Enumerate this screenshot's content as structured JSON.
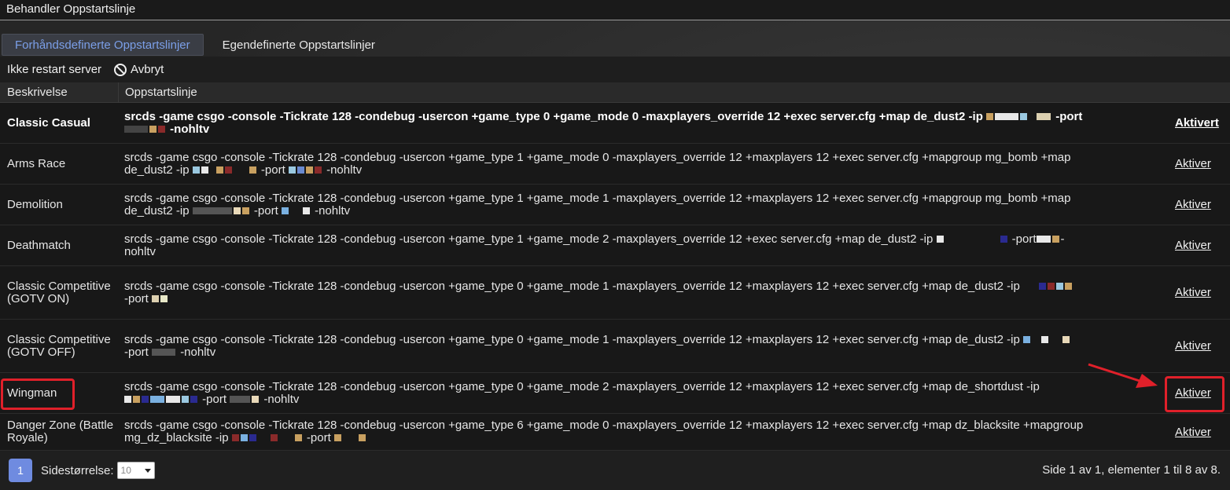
{
  "window": {
    "title": "Behandler Oppstartslinje"
  },
  "tabs": [
    {
      "label": "Forhåndsdefinerte Oppstartslinjer",
      "active": true
    },
    {
      "label": "Egendefinerte Oppstartslinjer",
      "active": false
    }
  ],
  "toolbar": {
    "no_restart_label": "Ikke restart server",
    "cancel_label": "Avbryt",
    "cancel_icon": "cancel-icon"
  },
  "table": {
    "headers": {
      "description": "Beskrivelse",
      "line": "Oppstartslinje"
    },
    "action_label_active": "Aktivert",
    "action_label": "Aktiver",
    "rows": [
      {
        "description": "Classic Casual",
        "line_a": "srcds -game csgo -console -Tickrate 128 -condebug -usercon +game_type 0 +game_mode 0 -maxplayers_override 12 +exec server.cfg +map de_dust2 -ip",
        "line_b": "-port",
        "line_c": "-nohltv",
        "action": "Aktivert",
        "active": true
      },
      {
        "description": "Arms Race",
        "line_a": "srcds -game csgo -console -Tickrate 128 -condebug -usercon +game_type 1 +game_mode 0 -maxplayers_override 12 +maxplayers 12 +exec server.cfg +mapgroup mg_bomb +map",
        "line_b": "de_dust2 -ip",
        "line_c": "-port",
        "line_d": "-nohltv",
        "action": "Aktiver"
      },
      {
        "description": "Demolition",
        "line_a": "srcds -game csgo -console -Tickrate 128 -condebug -usercon +game_type 1 +game_mode 1 -maxplayers_override 12 +maxplayers 12 +exec server.cfg +mapgroup mg_bomb +map",
        "line_b": "de_dust2 -ip",
        "line_c": "-port",
        "line_d": "-nohltv",
        "action": "Aktiver"
      },
      {
        "description": "Deathmatch",
        "line_a": "srcds -game csgo -console -Tickrate 128 -condebug -usercon +game_type 1 +game_mode 2 -maxplayers_override 12 +exec server.cfg +map de_dust2 -ip",
        "line_b": "-port",
        "line_c": "-",
        "line_d": "nohltv",
        "action": "Aktiver"
      },
      {
        "description": "Classic Competitive (GOTV ON)",
        "line_a": "srcds -game csgo -console -Tickrate 128 -condebug -usercon +game_type 0 +game_mode 1 -maxplayers_override 12 +maxplayers 12 +exec server.cfg +map de_dust2 -ip",
        "line_b": "-port",
        "action": "Aktiver"
      },
      {
        "description": "Classic Competitive (GOTV OFF)",
        "line_a": "srcds -game csgo -console -Tickrate 128 -condebug -usercon +game_type 0 +game_mode 1 -maxplayers_override 12 +maxplayers 12 +exec server.cfg +map de_dust2 -ip",
        "line_b": "-port",
        "line_c": "-nohltv",
        "action": "Aktiver"
      },
      {
        "description": "Wingman",
        "line_a": "srcds -game csgo -console -Tickrate 128 -condebug -usercon +game_type 0 +game_mode 2 -maxplayers_override 12 +maxplayers 12 +exec server.cfg +map de_shortdust -ip",
        "line_b": "-port",
        "line_c": "-nohltv",
        "action": "Aktiver",
        "highlighted": true
      },
      {
        "description": "Danger Zone (Battle Royale)",
        "line_a": "srcds -game csgo -console -Tickrate 128 -condebug -usercon +game_type 6 +game_mode 0 -maxplayers_override 12 +maxplayers 12 +exec server.cfg +map dz_blacksite +mapgroup",
        "line_b": "mg_dz_blacksite -ip",
        "line_c": "-port",
        "action": "Aktiver"
      }
    ]
  },
  "footer": {
    "current_page": "1",
    "page_size_label": "Sidestørrelse:",
    "page_size_value": "10",
    "page_info": "Side 1 av 1, elementer 1 til 8 av 8."
  },
  "colors": {
    "accent": "#7b9fe8",
    "page_button": "#6f8be0",
    "highlight": "#e0202a"
  }
}
